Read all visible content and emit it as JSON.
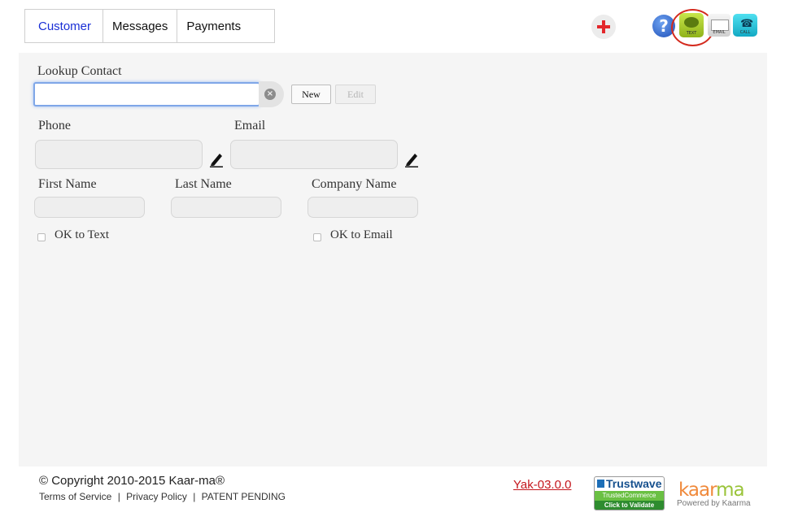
{
  "tabs": [
    {
      "label": "Customer",
      "active": true
    },
    {
      "label": "Messages",
      "active": false
    },
    {
      "label": "Payments",
      "active": false
    }
  ],
  "toolbar": {
    "help_glyph": "?",
    "text_label": "TEXT",
    "email_label": "EMAIL",
    "call_label": "CALL"
  },
  "form": {
    "lookup_label": "Lookup Contact",
    "lookup_value": "",
    "new_label": "New",
    "edit_label": "Edit",
    "phone_label": "Phone",
    "email_label": "Email",
    "first_name_label": "First Name",
    "last_name_label": "Last Name",
    "company_label": "Company Name",
    "ok_text_label": "OK to Text",
    "ok_email_label": "OK to Email"
  },
  "footer": {
    "copyright": "© Copyright 2010-2015 Kaar-ma®",
    "terms": "Terms of Service",
    "privacy": "Privacy Policy",
    "patent": "PATENT PENDING",
    "separator": "|",
    "version": "Yak-03.0.0",
    "trustwave_title": "Trustwave",
    "trustwave_sub": "TrustedCommerce",
    "trustwave_validate": "Click to Validate",
    "logo_part1": "kaar",
    "logo_part2": "ma",
    "powered_by": "Powered by Kaarma"
  },
  "colors": {
    "active_tab": "#1a2fd6",
    "accent_red": "#e3272b",
    "text_icon_green": "#a8cc2e",
    "call_icon_cyan": "#2cc6dc",
    "version_link": "#c4161c"
  }
}
